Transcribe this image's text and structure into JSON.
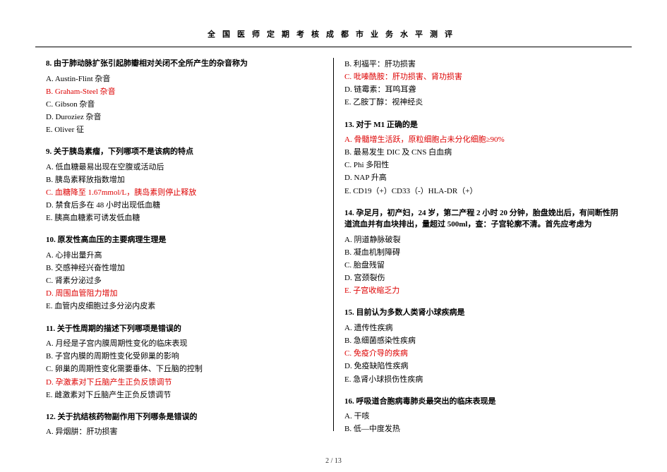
{
  "header": "全国医师定期考核成都市业务水平测评",
  "pager": "2 / 13",
  "left": [
    {
      "stem": "8. 由于肺动脉扩张引起肺瓣相对关闭不全所产生的杂音称为",
      "opts": [
        {
          "t": "A. Austin-Flint 杂音",
          "a": false
        },
        {
          "t": "B. Graham-Steel 杂音",
          "a": true
        },
        {
          "t": "C. Gibson 杂音",
          "a": false
        },
        {
          "t": "D. Duroziez 杂音",
          "a": false
        },
        {
          "t": "E. Oliver 征",
          "a": false
        }
      ]
    },
    {
      "stem": "9. 关于胰岛素瘤，下列哪项不是该病的特点",
      "opts": [
        {
          "t": "A. 低血糖最易出现在空腹或活动后",
          "a": false
        },
        {
          "t": "B. 胰岛素释放指数增加",
          "a": false
        },
        {
          "t": "C. 血糖降至 1.67mmol/L，胰岛素则停止释放",
          "a": true
        },
        {
          "t": "D. 禁食后多在 48 小时出现低血糖",
          "a": false
        },
        {
          "t": "E. 胰高血糖素可诱发低血糖",
          "a": false
        }
      ]
    },
    {
      "stem": "10. 原发性高血压的主要病理生理是",
      "opts": [
        {
          "t": "A. 心排出量升高",
          "a": false
        },
        {
          "t": "B. 交感神经兴奋性增加",
          "a": false
        },
        {
          "t": "C. 肾素分泌过多",
          "a": false
        },
        {
          "t": "D. 周围血管阻力增加",
          "a": true
        },
        {
          "t": "E. 血管内皮细胞过多分泌内皮素",
          "a": false
        }
      ]
    },
    {
      "stem": "11. 关于性周期的描述下列哪项是错误的",
      "opts": [
        {
          "t": "A. 月经是子宫内膜周期性变化的临床表现",
          "a": false
        },
        {
          "t": "B. 子宫内膜的周期性变化受卵巢的影响",
          "a": false
        },
        {
          "t": "C. 卵巢的周期性变化需要垂体、下丘脑的控制",
          "a": false
        },
        {
          "t": "D. 孕激素对下丘脑产生正负反馈调节",
          "a": true
        },
        {
          "t": "E. 雌激素对下丘脑产生正负反馈调节",
          "a": false
        }
      ]
    },
    {
      "stem": "12. 关于抗结核药物副作用下列哪条是错误的",
      "opts": [
        {
          "t": "A. 异烟肼：肝功损害",
          "a": false
        }
      ]
    }
  ],
  "right": [
    {
      "stem": "",
      "opts": [
        {
          "t": "B. 利福平：肝功损害",
          "a": false
        },
        {
          "t": "C. 吡嗪酰胺：肝功损害、肾功损害",
          "a": true
        },
        {
          "t": "D. 链霉素：耳鸣耳聋",
          "a": false
        },
        {
          "t": "E. 乙胺丁醇：视神经炎",
          "a": false
        }
      ]
    },
    {
      "stem": "13. 对于 M1 正确的是",
      "opts": [
        {
          "t": "A. 骨髓增生活跃，原粒细胞占未分化细胞≥90%",
          "a": true
        },
        {
          "t": "B. 最易发生 DIC 及 CNS 白血病",
          "a": false
        },
        {
          "t": "C. Phi 多阳性",
          "a": false
        },
        {
          "t": "D. NAP 升高",
          "a": false
        },
        {
          "t": "E. CD19（+）CD33（-）HLA-DR（+）",
          "a": false
        }
      ]
    },
    {
      "stem": "14. 孕足月，初产妇，24 岁，第二产程 2 小时 20 分钟，胎盘娩出后，有间断性阴道流血并有血块排出，量超过 500ml，查：子宫轮廓不清。首先应考虑为",
      "opts": [
        {
          "t": "A. 阴道静脉破裂",
          "a": false
        },
        {
          "t": "B. 凝血机制障碍",
          "a": false
        },
        {
          "t": "C. 胎盘残留",
          "a": false
        },
        {
          "t": "D. 宫颈裂伤",
          "a": false
        },
        {
          "t": "E. 子宫收缩乏力",
          "a": true
        }
      ]
    },
    {
      "stem": "15. 目前认为多数人类肾小球疾病是",
      "opts": [
        {
          "t": "A. 遗传性疾病",
          "a": false
        },
        {
          "t": "B. 急细菌感染性疾病",
          "a": false
        },
        {
          "t": "C. 免疫介导的疾病",
          "a": true
        },
        {
          "t": "D. 免疫缺陷性疾病",
          "a": false
        },
        {
          "t": "E. 急肾小球损伤性疾病",
          "a": false
        }
      ]
    },
    {
      "stem": "16. 呼吸道合胞病毒肺炎最突出的临床表现是",
      "opts": [
        {
          "t": "A. 干咳",
          "a": false
        },
        {
          "t": "B. 低—中度发热",
          "a": false
        }
      ]
    }
  ]
}
